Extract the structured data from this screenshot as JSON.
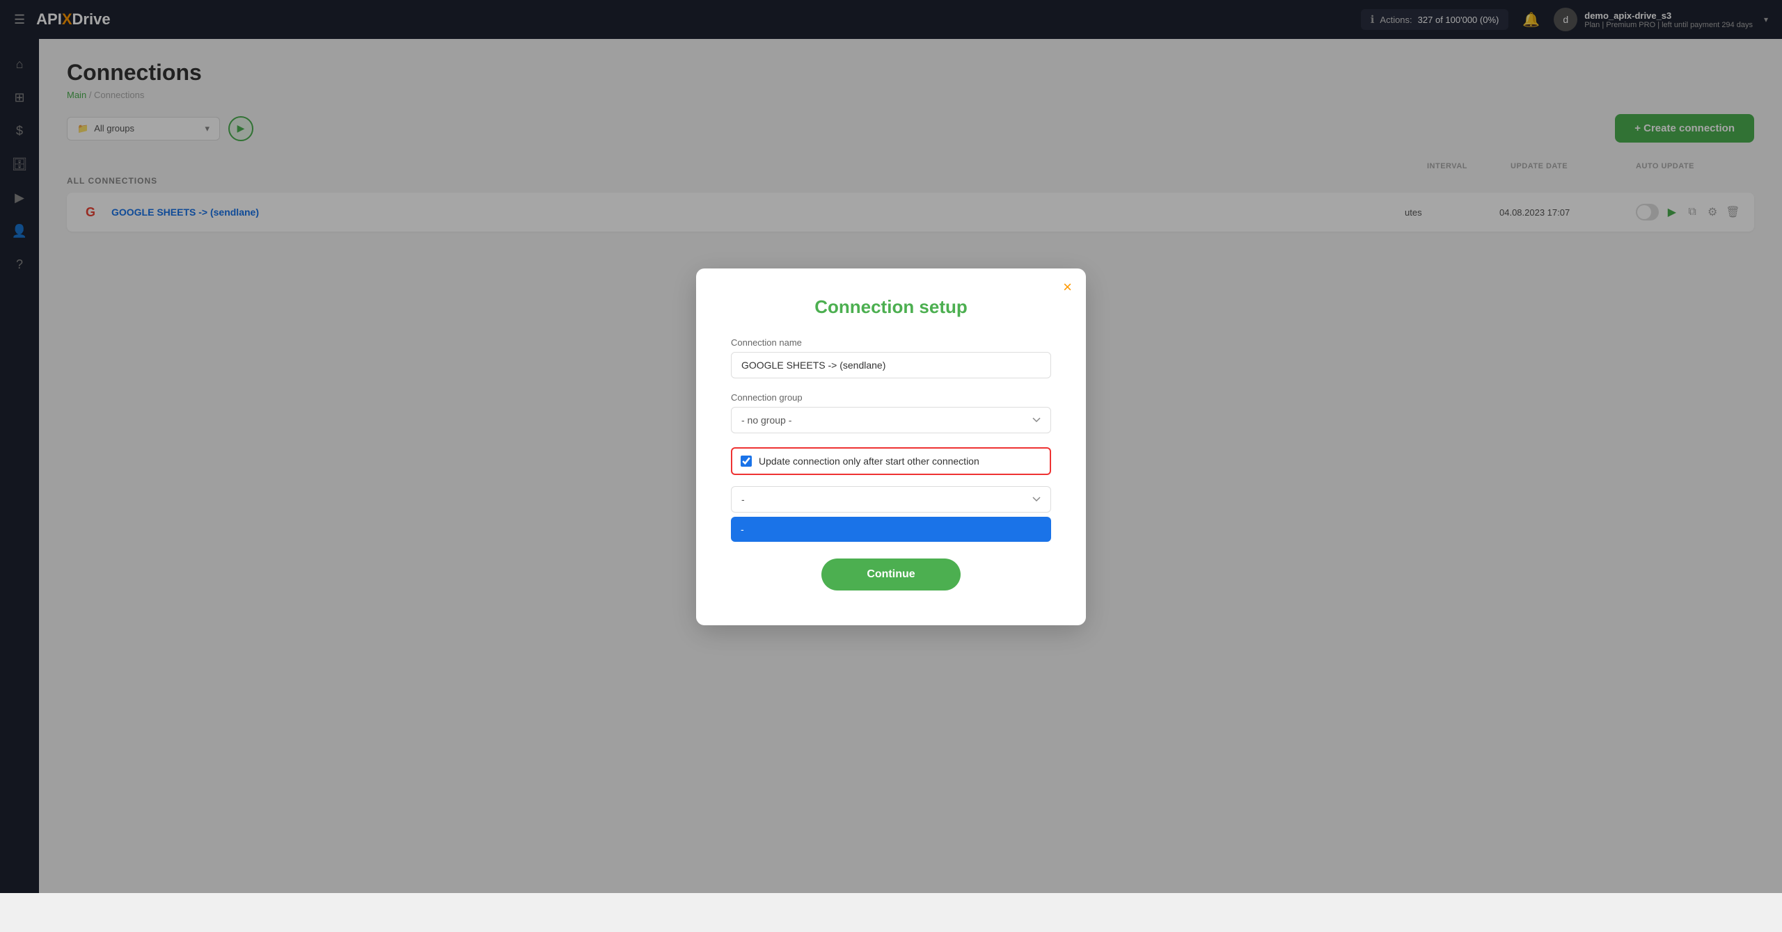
{
  "navbar": {
    "logo": {
      "api": "API",
      "x": "X",
      "drive": "Drive"
    },
    "actions": {
      "label": "Actions:",
      "count": "327 of 100'000 (0%)"
    },
    "user": {
      "name": "demo_apix-drive_s3",
      "plan": "Plan | Premium PRO | left until payment 294 days",
      "avatar_letter": "d"
    }
  },
  "sidebar": {
    "items": [
      {
        "icon": "☰",
        "name": "menu-icon"
      },
      {
        "icon": "⌂",
        "name": "home-icon"
      },
      {
        "icon": "⊞",
        "name": "grid-icon"
      },
      {
        "icon": "$",
        "name": "dollar-icon"
      },
      {
        "icon": "🗄",
        "name": "briefcase-icon"
      },
      {
        "icon": "▶",
        "name": "play-icon"
      },
      {
        "icon": "👤",
        "name": "user-icon"
      },
      {
        "icon": "?",
        "name": "help-icon"
      }
    ]
  },
  "page": {
    "title": "Connections",
    "breadcrumb_main": "Main",
    "breadcrumb_separator": " / ",
    "breadcrumb_current": "Connections",
    "all_connections_label": "ALL CONNECTIONS",
    "group_select_label": "All groups",
    "create_button": "+ Create connection"
  },
  "table": {
    "headers": {
      "interval": "INTERVAL",
      "update_date": "UPDATE DATE",
      "auto_update": "AUTO UPDATE"
    },
    "rows": [
      {
        "icon": "G",
        "name": "GOOGLE SHEETS -> (sendlane)",
        "interval": "utes",
        "update_date": "04.08.2023 17:07"
      }
    ]
  },
  "modal": {
    "title": "Connection setup",
    "close_label": "×",
    "connection_name_label": "Connection name",
    "connection_name_value": "GOOGLE SHEETS -> (sendlane)",
    "connection_group_label": "Connection group",
    "connection_group_value": "- no group -",
    "connection_group_options": [
      "- no group -"
    ],
    "checkbox_label": "Update connection only after start other connection",
    "checkbox_checked": true,
    "dropdown_value": "-",
    "dropdown_selected_value": "-",
    "continue_button": "Continue"
  }
}
